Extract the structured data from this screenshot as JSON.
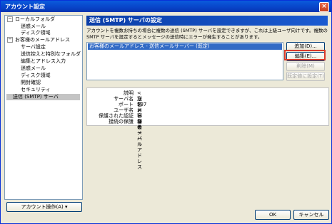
{
  "window": {
    "title": "アカウント設定"
  },
  "tree": [
    {
      "label": "ローカルフォルダ",
      "toggle": "−"
    },
    {
      "label": "迷惑メール"
    },
    {
      "label": "ディスク領域"
    },
    {
      "label": "お客様のメールアドレス",
      "toggle": "−"
    },
    {
      "label": "サーバ設定"
    },
    {
      "label": "送信控えと特別なフォルダ"
    },
    {
      "label": "編集とアドレス入力"
    },
    {
      "label": "迷惑メール"
    },
    {
      "label": "ディスク領域"
    },
    {
      "label": "開封確認"
    },
    {
      "label": "セキュリティ"
    },
    {
      "label": "送信 (SMTP) サーバ"
    }
  ],
  "account_actions": "アカウント操作(A)",
  "header": "送信 (SMTP) サーバの設定",
  "description": "アカウントを複数お持ちの場合に複数の送信 (SMTP) サーバを設定できますが、これは上級ユーザ向けです。複数の SMTP サーバを設定するとメッセージの送信時にエラーが発生することがあります。",
  "server_list": [
    "お客様のメールアドレス - 送信メールサーバー (既定)"
  ],
  "buttons": {
    "add": "追加(D)...",
    "edit": "編集(E)...",
    "delete": "削除(M)",
    "default": "既定値に設定(T)"
  },
  "details": [
    {
      "label": "説明",
      "value": "<なし>"
    },
    {
      "label": "サーバ名",
      "value": "送信メールサーバー"
    },
    {
      "label": "ポート",
      "value": "587"
    },
    {
      "label": "ユーザ名",
      "value": "お客様のメールアドレス"
    },
    {
      "label": "保護された認証",
      "value": "いいえ"
    },
    {
      "label": "接続の保護",
      "value": "なし"
    }
  ],
  "footer": {
    "ok": "OK",
    "cancel": "キャンセル"
  }
}
